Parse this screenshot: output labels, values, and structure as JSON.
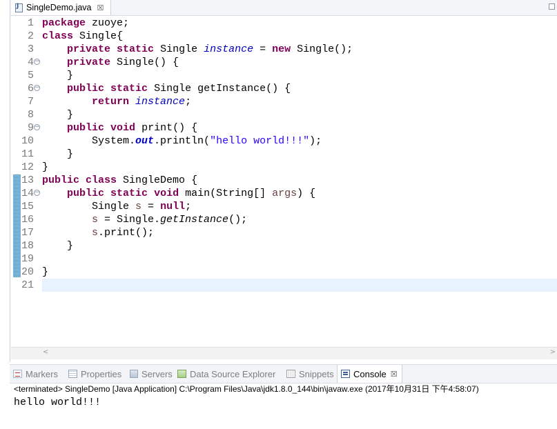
{
  "editor": {
    "tab_label": "SingleDemo.java",
    "tab_close": "☒",
    "lines": [
      {
        "n": "1",
        "fold": false,
        "tokens": [
          {
            "t": "package",
            "c": "kw"
          },
          {
            "t": " zuoye;",
            "c": ""
          }
        ]
      },
      {
        "n": "2",
        "fold": false,
        "tokens": [
          {
            "t": "class",
            "c": "kw"
          },
          {
            "t": " Single{",
            "c": ""
          }
        ]
      },
      {
        "n": "3",
        "fold": false,
        "tokens": [
          {
            "t": "    ",
            "c": ""
          },
          {
            "t": "private",
            "c": "kw"
          },
          {
            "t": " ",
            "c": ""
          },
          {
            "t": "static",
            "c": "kw"
          },
          {
            "t": " Single ",
            "c": ""
          },
          {
            "t": "instance",
            "c": "fld"
          },
          {
            "t": " = ",
            "c": ""
          },
          {
            "t": "new",
            "c": "kw"
          },
          {
            "t": " Single();",
            "c": ""
          }
        ]
      },
      {
        "n": "4",
        "fold": true,
        "tokens": [
          {
            "t": "    ",
            "c": ""
          },
          {
            "t": "private",
            "c": "kw"
          },
          {
            "t": " Single() {",
            "c": ""
          }
        ]
      },
      {
        "n": "5",
        "fold": false,
        "tokens": [
          {
            "t": "    }",
            "c": ""
          }
        ]
      },
      {
        "n": "6",
        "fold": true,
        "tokens": [
          {
            "t": "    ",
            "c": ""
          },
          {
            "t": "public",
            "c": "kw"
          },
          {
            "t": " ",
            "c": ""
          },
          {
            "t": "static",
            "c": "kw"
          },
          {
            "t": " Single getInstance() {",
            "c": ""
          }
        ]
      },
      {
        "n": "7",
        "fold": false,
        "tokens": [
          {
            "t": "        ",
            "c": ""
          },
          {
            "t": "return",
            "c": "kw"
          },
          {
            "t": " ",
            "c": ""
          },
          {
            "t": "instance",
            "c": "fld"
          },
          {
            "t": ";",
            "c": ""
          }
        ]
      },
      {
        "n": "8",
        "fold": false,
        "tokens": [
          {
            "t": "    }",
            "c": ""
          }
        ]
      },
      {
        "n": "9",
        "fold": true,
        "tokens": [
          {
            "t": "    ",
            "c": ""
          },
          {
            "t": "public",
            "c": "kw"
          },
          {
            "t": " ",
            "c": ""
          },
          {
            "t": "void",
            "c": "kw"
          },
          {
            "t": " print() {",
            "c": ""
          }
        ]
      },
      {
        "n": "10",
        "fold": false,
        "tokens": [
          {
            "t": "        System.",
            "c": ""
          },
          {
            "t": "out",
            "c": "fldb"
          },
          {
            "t": ".println(",
            "c": ""
          },
          {
            "t": "\"hello world!!!\"",
            "c": "str"
          },
          {
            "t": ");",
            "c": ""
          }
        ]
      },
      {
        "n": "11",
        "fold": false,
        "tokens": [
          {
            "t": "    }",
            "c": ""
          }
        ]
      },
      {
        "n": "12",
        "fold": false,
        "tokens": [
          {
            "t": "}",
            "c": ""
          }
        ]
      },
      {
        "n": "13",
        "fold": false,
        "tokens": [
          {
            "t": "public",
            "c": "kw"
          },
          {
            "t": " ",
            "c": ""
          },
          {
            "t": "class",
            "c": "kw"
          },
          {
            "t": " SingleDemo {",
            "c": ""
          }
        ]
      },
      {
        "n": "14",
        "fold": true,
        "tokens": [
          {
            "t": "    ",
            "c": ""
          },
          {
            "t": "public",
            "c": "kw"
          },
          {
            "t": " ",
            "c": ""
          },
          {
            "t": "static",
            "c": "kw"
          },
          {
            "t": " ",
            "c": ""
          },
          {
            "t": "void",
            "c": "kw"
          },
          {
            "t": " main(String[] ",
            "c": ""
          },
          {
            "t": "args",
            "c": "par"
          },
          {
            "t": ") {",
            "c": ""
          }
        ]
      },
      {
        "n": "15",
        "fold": false,
        "tokens": [
          {
            "t": "        Single ",
            "c": ""
          },
          {
            "t": "s",
            "c": "par"
          },
          {
            "t": " = ",
            "c": ""
          },
          {
            "t": "null",
            "c": "kw"
          },
          {
            "t": ";",
            "c": ""
          }
        ]
      },
      {
        "n": "16",
        "fold": false,
        "tokens": [
          {
            "t": "        ",
            "c": ""
          },
          {
            "t": "s",
            "c": "par"
          },
          {
            "t": " = Single.",
            "c": ""
          },
          {
            "t": "getInstance",
            "c": "mi"
          },
          {
            "t": "();",
            "c": ""
          }
        ]
      },
      {
        "n": "17",
        "fold": false,
        "tokens": [
          {
            "t": "        ",
            "c": ""
          },
          {
            "t": "s",
            "c": "par"
          },
          {
            "t": ".print();",
            "c": ""
          }
        ]
      },
      {
        "n": "18",
        "fold": false,
        "tokens": [
          {
            "t": "    }",
            "c": ""
          }
        ]
      },
      {
        "n": "19",
        "fold": false,
        "tokens": []
      },
      {
        "n": "20",
        "fold": false,
        "tokens": [
          {
            "t": "}",
            "c": ""
          }
        ]
      },
      {
        "n": "21",
        "fold": false,
        "tokens": []
      }
    ],
    "current_line": "21"
  },
  "panel": {
    "tabs": [
      {
        "id": "markers",
        "label": "Markers",
        "icon": "markers-icon",
        "active": false
      },
      {
        "id": "properties",
        "label": "Properties",
        "icon": "properties-icon",
        "active": false
      },
      {
        "id": "servers",
        "label": "Servers",
        "icon": "servers-icon",
        "active": false
      },
      {
        "id": "data-source-explorer",
        "label": "Data Source Explorer",
        "icon": "data-source-explorer-icon",
        "active": false
      },
      {
        "id": "snippets",
        "label": "Snippets",
        "icon": "snippets-icon",
        "active": false
      },
      {
        "id": "console",
        "label": "Console",
        "icon": "console-icon",
        "active": true
      }
    ],
    "console_close": "☒",
    "status": "<terminated> SingleDemo [Java Application] C:\\Program Files\\Java\\jdk1.8.0_144\\bin\\javaw.exe (2017年10月31日 下午4:58:07)",
    "output": "hello world!!!"
  },
  "colors": {
    "keyword": "#7f0055",
    "field": "#0000c0",
    "string": "#2a00ff",
    "current_line": "#e8f2fe",
    "line_number": "#787878"
  }
}
